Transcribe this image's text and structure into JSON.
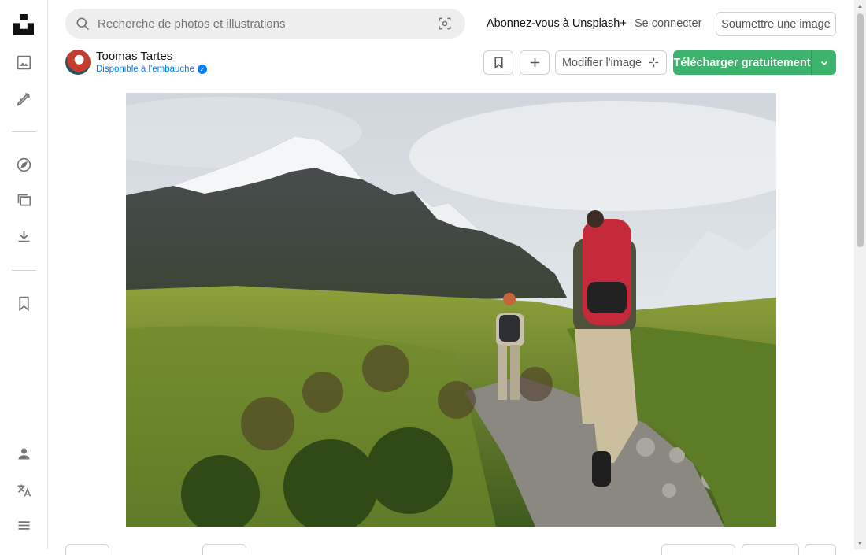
{
  "search": {
    "placeholder": "Recherche de photos et illustrations"
  },
  "header": {
    "plus_link": "Abonnez-vous à Unsplash+",
    "login_link": "Se connecter",
    "submit_button": "Soumettre une image"
  },
  "photographer": {
    "name": "Toomas Tartes",
    "hire_status": "Disponible à l'embauche"
  },
  "actions": {
    "edit_label": "Modifier l'image",
    "download_label": "Télécharger gratuitement"
  },
  "sidebar": {
    "icons": [
      "unsplash-logo-icon",
      "photos-icon",
      "illustrations-icon",
      "explore-icon",
      "collections-icon",
      "downloads-icon",
      "bookmark-icon",
      "user-icon",
      "language-icon",
      "menu-icon"
    ]
  },
  "colors": {
    "accent_green": "#3cb46e",
    "link_blue": "#007fff",
    "search_bg": "#eeeeee"
  }
}
